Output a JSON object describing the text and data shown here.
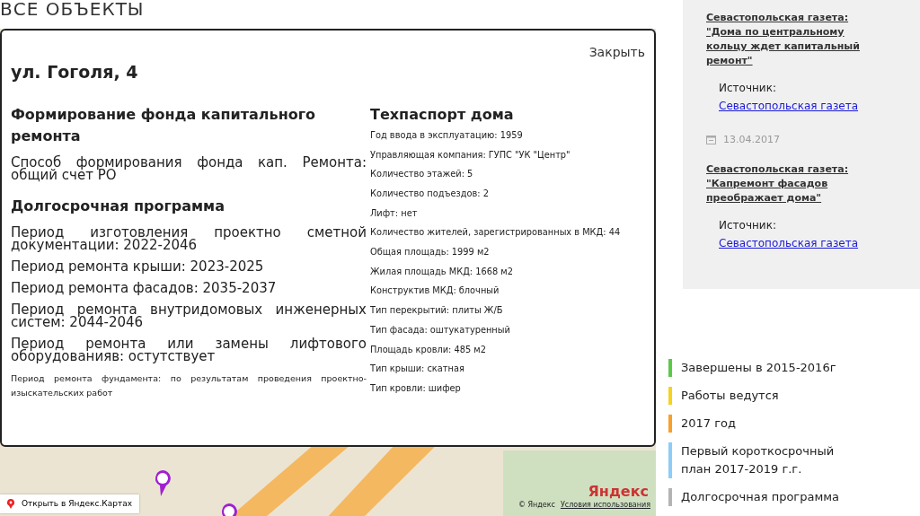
{
  "page_heading": "ВСЕ ОБЪЕКТЫ",
  "modal": {
    "close": "Закрыть",
    "title": "ул. Гоголя, 4",
    "sections": [
      {
        "heading": "Формирование фонда капитального ремонта",
        "items": [
          {
            "kind": "large",
            "text": "Способ формирования фонда кап. Ремонта: общий счет РО"
          }
        ]
      },
      {
        "heading": "Долгосрочная программа",
        "items": [
          {
            "kind": "large",
            "text": "Период изготовления проектно сметной документации: 2022-2046"
          },
          {
            "kind": "large",
            "text": "Период ремонта крыши: 2023-2025"
          },
          {
            "kind": "large",
            "text": "Период ремонта фасадов: 2035-2037"
          },
          {
            "kind": "large",
            "text": "Период ремонта внутридомовых инженерных систем: 2044-2046"
          },
          {
            "kind": "large",
            "text": "Период ремонта или замены лифтового оборудованияв: остутствует"
          },
          {
            "kind": "small",
            "text": "Период ремонта фундамента: по результатам проведения проектно-изыскательских работ"
          }
        ]
      }
    ],
    "passport": {
      "heading": "Техпаспорт дома",
      "items": [
        "Год ввода в эксплуатацию: 1959",
        "Управляющая компания: ГУПС \"УК \"Центр\"",
        "Количество этажей: 5",
        "Количество подъездов: 2",
        "Лифт: нет",
        "Количество жителей, зарегистрированных в МКД: 44",
        "Общая площадь: 1999 м2",
        "Жилая площадь МКД: 1668 м2",
        "Конструктив МКД: блочный",
        "Тип перекрытий: плиты Ж/Б",
        "Тип фасада: оштукатуренный",
        "Площадь кровли: 485 м2",
        "Тип крыши: скатная",
        "Тип кровли: шифер"
      ]
    }
  },
  "map": {
    "open_button": "Открыть в Яндекс.Картах",
    "logo": "Яндекс",
    "copyright": "© Яндекс",
    "terms_link": "Условия использования"
  },
  "news": [
    {
      "title": "Севастопольская газета: \"Дома по центральному кольцу ждет капитальный ремонт\"",
      "source_label": "Источник:",
      "source": "Севастопольская газета"
    },
    {
      "date": "13.04.2017",
      "title": "Севастопольская газета: \"Капремонт фасадов преображает дома\"",
      "source_label": "Источник:",
      "source": "Севастопольская газета"
    }
  ],
  "legend": [
    {
      "label": "Завершены в 2015-2016г",
      "color": "#5cc84a"
    },
    {
      "label": "Работы ведутся",
      "color": "#f5d21e"
    },
    {
      "label": "2017 год",
      "color": "#f7a12c"
    },
    {
      "label": "Первый короткосрочный план 2017-2019 г.г.",
      "color": "#8dcdf8"
    },
    {
      "label": "Долгосрочная программа",
      "color": "#b4b4b4"
    }
  ]
}
